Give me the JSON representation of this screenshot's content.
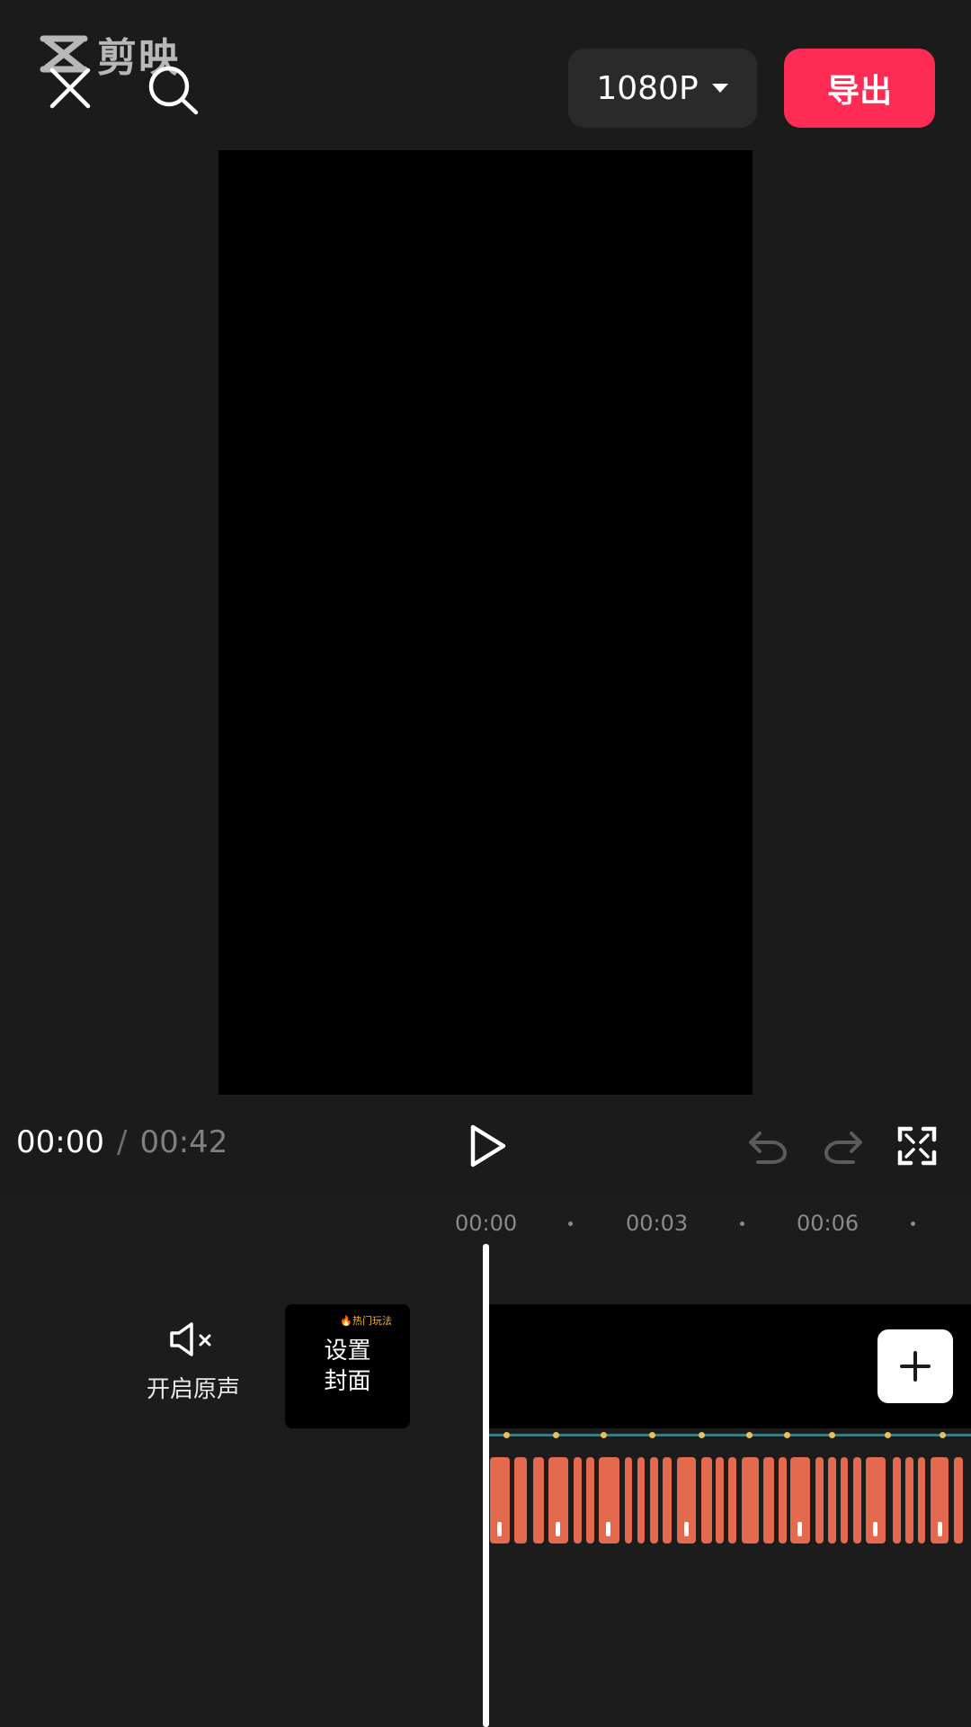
{
  "watermark": {
    "text": "剪映",
    "icon": "capcut-logo-icon"
  },
  "header": {
    "close_icon": "close-icon",
    "search_icon": "search-icon",
    "resolution": "1080P",
    "export_label": "导出"
  },
  "player": {
    "current_time": "00:00",
    "separator": "/",
    "total_time": "00:42",
    "play_icon": "play-icon",
    "undo_icon": "undo-icon",
    "redo_icon": "redo-icon",
    "fullscreen_icon": "fullscreen-icon"
  },
  "timeline": {
    "ruler": [
      "00:00",
      "00:03",
      "00:06"
    ],
    "mute_label": "开启原声",
    "cover_badge": "🔥热门玩法",
    "cover_label_line1": "设置",
    "cover_label_line2": "封面",
    "add_clip_icon": "plus-icon"
  },
  "colors": {
    "export": "#fe2c55",
    "audio_wave": "#e46a4f",
    "beat_line": "#3b7c80",
    "beat_dot": "#e6c35a"
  }
}
